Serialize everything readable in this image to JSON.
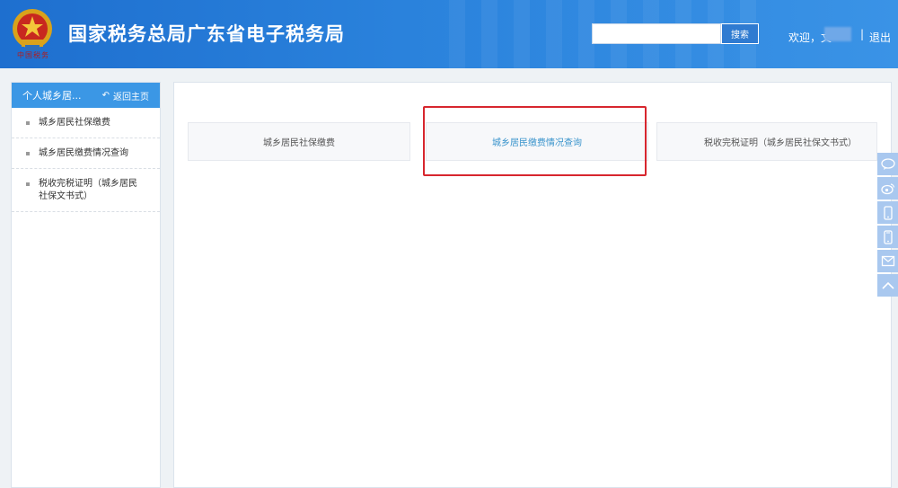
{
  "header": {
    "site_title": "国家税务总局广东省电子税务局",
    "emblem_caption": "中国税务",
    "search_button": "搜索",
    "search_placeholder": "",
    "welcome_text": "欢迎，文",
    "separator": "|",
    "logout_label": "退出"
  },
  "sidebar": {
    "header_title": "个人城乡居...",
    "back_home_label": "返回主页",
    "items": [
      {
        "label": "城乡居民社保缴费"
      },
      {
        "label": "城乡居民缴费情况查询"
      },
      {
        "label": "税收完税证明（城乡居民社保文书式）"
      }
    ]
  },
  "main": {
    "cards": [
      {
        "label": "城乡居民社保缴费"
      },
      {
        "label": "城乡居民缴费情况查询"
      },
      {
        "label": "税收完税证明（城乡居民社保文书式）"
      }
    ]
  },
  "float_bar": {
    "icons": [
      "chat-icon",
      "weibo-icon",
      "phone-icon",
      "mobile-icon",
      "mail-icon",
      "back-to-top-icon"
    ]
  },
  "colors": {
    "header_blue": "#2a82dc",
    "sidebar_header": "#3b97e5",
    "active_link": "#3a94cc",
    "highlight_red": "#d7262e"
  }
}
